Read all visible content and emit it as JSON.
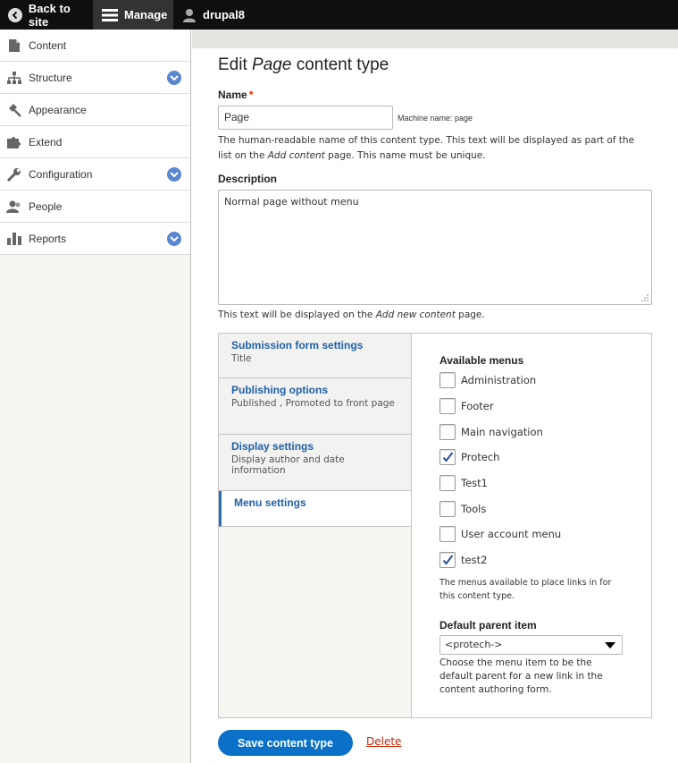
{
  "toolbar": {
    "back_label": "Back to site",
    "manage_label": "Manage",
    "user_label": "drupal8"
  },
  "sidebar": {
    "items": [
      {
        "label": "Content",
        "icon": "content-icon",
        "expandable": false
      },
      {
        "label": "Structure",
        "icon": "structure-icon",
        "expandable": true
      },
      {
        "label": "Appearance",
        "icon": "appearance-icon",
        "expandable": false
      },
      {
        "label": "Extend",
        "icon": "extend-icon",
        "expandable": false
      },
      {
        "label": "Configuration",
        "icon": "configuration-icon",
        "expandable": true
      },
      {
        "label": "People",
        "icon": "people-icon",
        "expandable": false
      },
      {
        "label": "Reports",
        "icon": "reports-icon",
        "expandable": true
      }
    ]
  },
  "page": {
    "title_prefix": "Edit",
    "title_em": "Page",
    "title_suffix": "content type"
  },
  "form": {
    "name_label": "Name",
    "required_mark": "*",
    "name_value": "Page",
    "machine_name": "Machine name: page",
    "name_help_1": "The human-readable name of this content type. This text will be displayed as part of the",
    "name_help_2a": "list on the ",
    "name_help_2em": "Add content",
    "name_help_2b": " page. This name must be unique.",
    "description_label": "Description",
    "description_value": "Normal page without menu",
    "description_help_a": "This text will be displayed on the ",
    "description_help_em": "Add new content",
    "description_help_b": " page."
  },
  "vertical_tabs": [
    {
      "title": "Submission form settings",
      "summary": "Title"
    },
    {
      "title": "Publishing options",
      "summary": "Published , Promoted to front page"
    },
    {
      "title": "Display settings",
      "summary": "Display author and date information"
    },
    {
      "title": "Menu settings",
      "summary": "",
      "active": true
    }
  ],
  "menu_settings": {
    "available_label": "Available menus",
    "menus": [
      {
        "label": "Administration",
        "checked": false
      },
      {
        "label": "Footer",
        "checked": false
      },
      {
        "label": "Main navigation",
        "checked": false
      },
      {
        "label": "Protech",
        "checked": true
      },
      {
        "label": "Test1",
        "checked": false
      },
      {
        "label": "Tools",
        "checked": false
      },
      {
        "label": "User account menu",
        "checked": false
      },
      {
        "label": "test2",
        "checked": true
      }
    ],
    "menus_help": "The menus available to place links in for this content type.",
    "default_parent_label": "Default parent item",
    "default_parent_value": "<protech->",
    "default_parent_help": "Choose the menu item to be the default parent for a new link in the content authoring form."
  },
  "actions": {
    "save_label": "Save content type",
    "delete_label": "Delete"
  },
  "colors": {
    "toolbar_bg": "#0f0f0f",
    "accent_blue": "#0a70c8",
    "link_blue": "#1f5fa8",
    "delete_red": "#c4260a",
    "required_red": "#e62600"
  }
}
